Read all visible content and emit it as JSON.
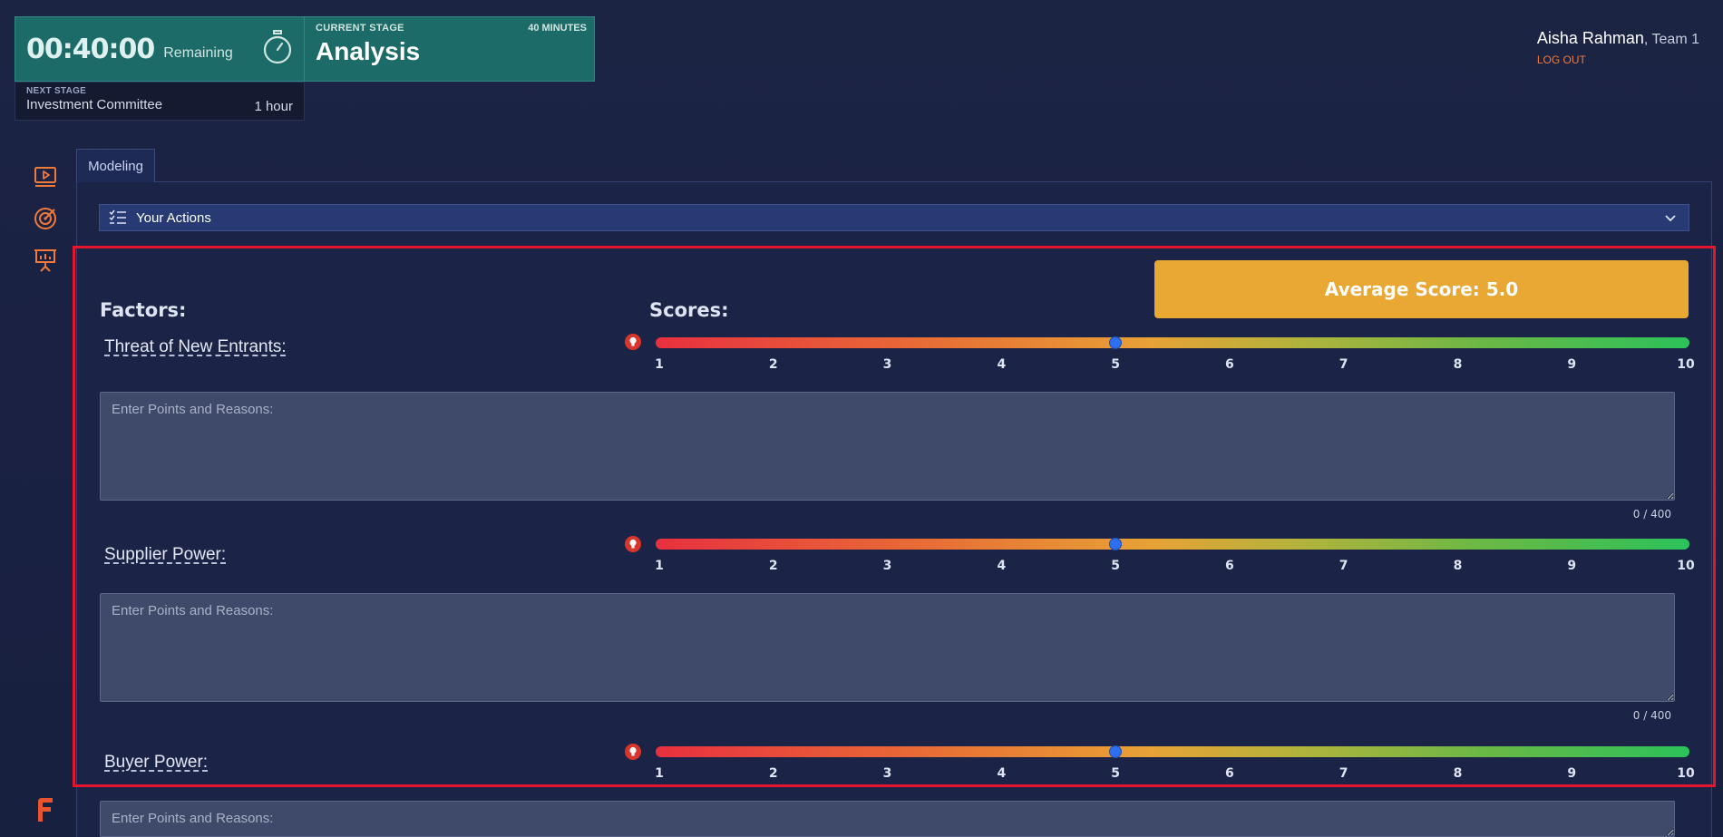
{
  "timer": {
    "time": "00:40:00",
    "remaining_label": "Remaining",
    "icon": "stopwatch-icon"
  },
  "current_stage": {
    "label": "CURRENT STAGE",
    "duration": "40 MINUTES",
    "name": "Analysis"
  },
  "next_stage": {
    "label": "NEXT STAGE",
    "name": "Investment Committee",
    "duration": "1 hour"
  },
  "user": {
    "name": "Aisha Rahman",
    "team": ", Team 1",
    "logout": "LOG OUT"
  },
  "rail": {
    "icons": [
      "video-icon",
      "target-icon",
      "presentation-icon"
    ],
    "logo_icon": "brand-f-logo-icon"
  },
  "tabs": [
    {
      "label": "Modeling"
    }
  ],
  "actions": {
    "label": "Your Actions",
    "icon": "checklist-icon",
    "chevron": "chevron-down-icon"
  },
  "average_score": "Average Score: 5.0",
  "headings": {
    "factors": "Factors:",
    "scores": "Scores:"
  },
  "scale": {
    "min": 1,
    "max": 10,
    "ticks": [
      "1",
      "2",
      "3",
      "4",
      "5",
      "6",
      "7",
      "8",
      "9",
      "10"
    ]
  },
  "factors": [
    {
      "label": "Threat of New Entrants:",
      "score": 5,
      "placeholder": "Enter Points and Reasons:",
      "count": "0 / 400"
    },
    {
      "label": "Supplier Power:",
      "score": 5,
      "placeholder": "Enter Points and Reasons:",
      "count": "0 / 400"
    },
    {
      "label": "Buyer Power:",
      "score": 5,
      "placeholder": "Enter Points and Reasons:",
      "count": ""
    }
  ],
  "colors": {
    "accent_orange": "#f07a3a",
    "stage_teal": "#1c6b68",
    "avg_score_bg": "#e8a833",
    "slider_thumb": "#2c6ff0",
    "highlight_red": "#e3162e"
  }
}
